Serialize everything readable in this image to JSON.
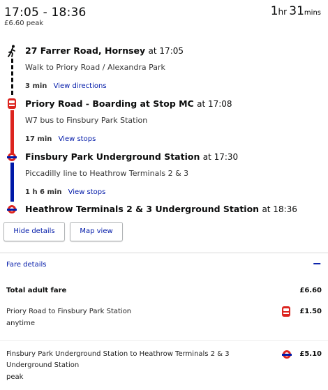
{
  "summary": {
    "time_range": "17:05 - 18:36",
    "price": "£6.60 peak",
    "duration_hours": "1",
    "duration_hours_unit": "hr",
    "duration_mins": "31",
    "duration_mins_unit": "mins"
  },
  "legs": [
    {
      "stop_name": "27 Farrer Road, Hornsey",
      "stop_time": "at 17:05",
      "description": "Walk to Priory Road / Alexandra Park",
      "duration": "3 min",
      "link": "View directions",
      "mode_icon": "walking-person-icon"
    },
    {
      "stop_name": "Priory Road - Boarding at Stop MC",
      "stop_time": "at 17:08",
      "description": "W7 bus to Finsbury Park Station",
      "duration": "17 min",
      "link": "View stops",
      "mode_icon": "bus-icon"
    },
    {
      "stop_name": "Finsbury Park Underground Station",
      "stop_time": "at 17:30",
      "description": "Piccadilly line to Heathrow Terminals 2 & 3",
      "duration": "1 h 6 min",
      "link": "View stops",
      "mode_icon": "underground-roundel-icon"
    }
  ],
  "destination": {
    "stop_name": "Heathrow Terminals 2 & 3 Underground Station",
    "stop_time": "at 18:36",
    "mode_icon": "underground-roundel-icon"
  },
  "buttons": {
    "hide_details": "Hide details",
    "map_view": "Map view"
  },
  "fare": {
    "header": "Fare details",
    "collapse_symbol": "−",
    "total_label": "Total adult fare",
    "total_value": "£6.60",
    "rows": [
      {
        "route": "Priory Road to Finsbury Park Station",
        "type": "anytime",
        "price": "£1.50",
        "icon": "bus-icon"
      },
      {
        "route_line1": "Finsbury Park Underground Station to Heathrow Terminals 2 & 3",
        "route_line2": "Underground Station",
        "type": "peak",
        "price": "£5.10",
        "icon": "underground-roundel-icon"
      }
    ]
  },
  "colors": {
    "link_blue": "#0019a8",
    "bus_red": "#dc241f",
    "piccadilly_blue": "#0019a8"
  }
}
